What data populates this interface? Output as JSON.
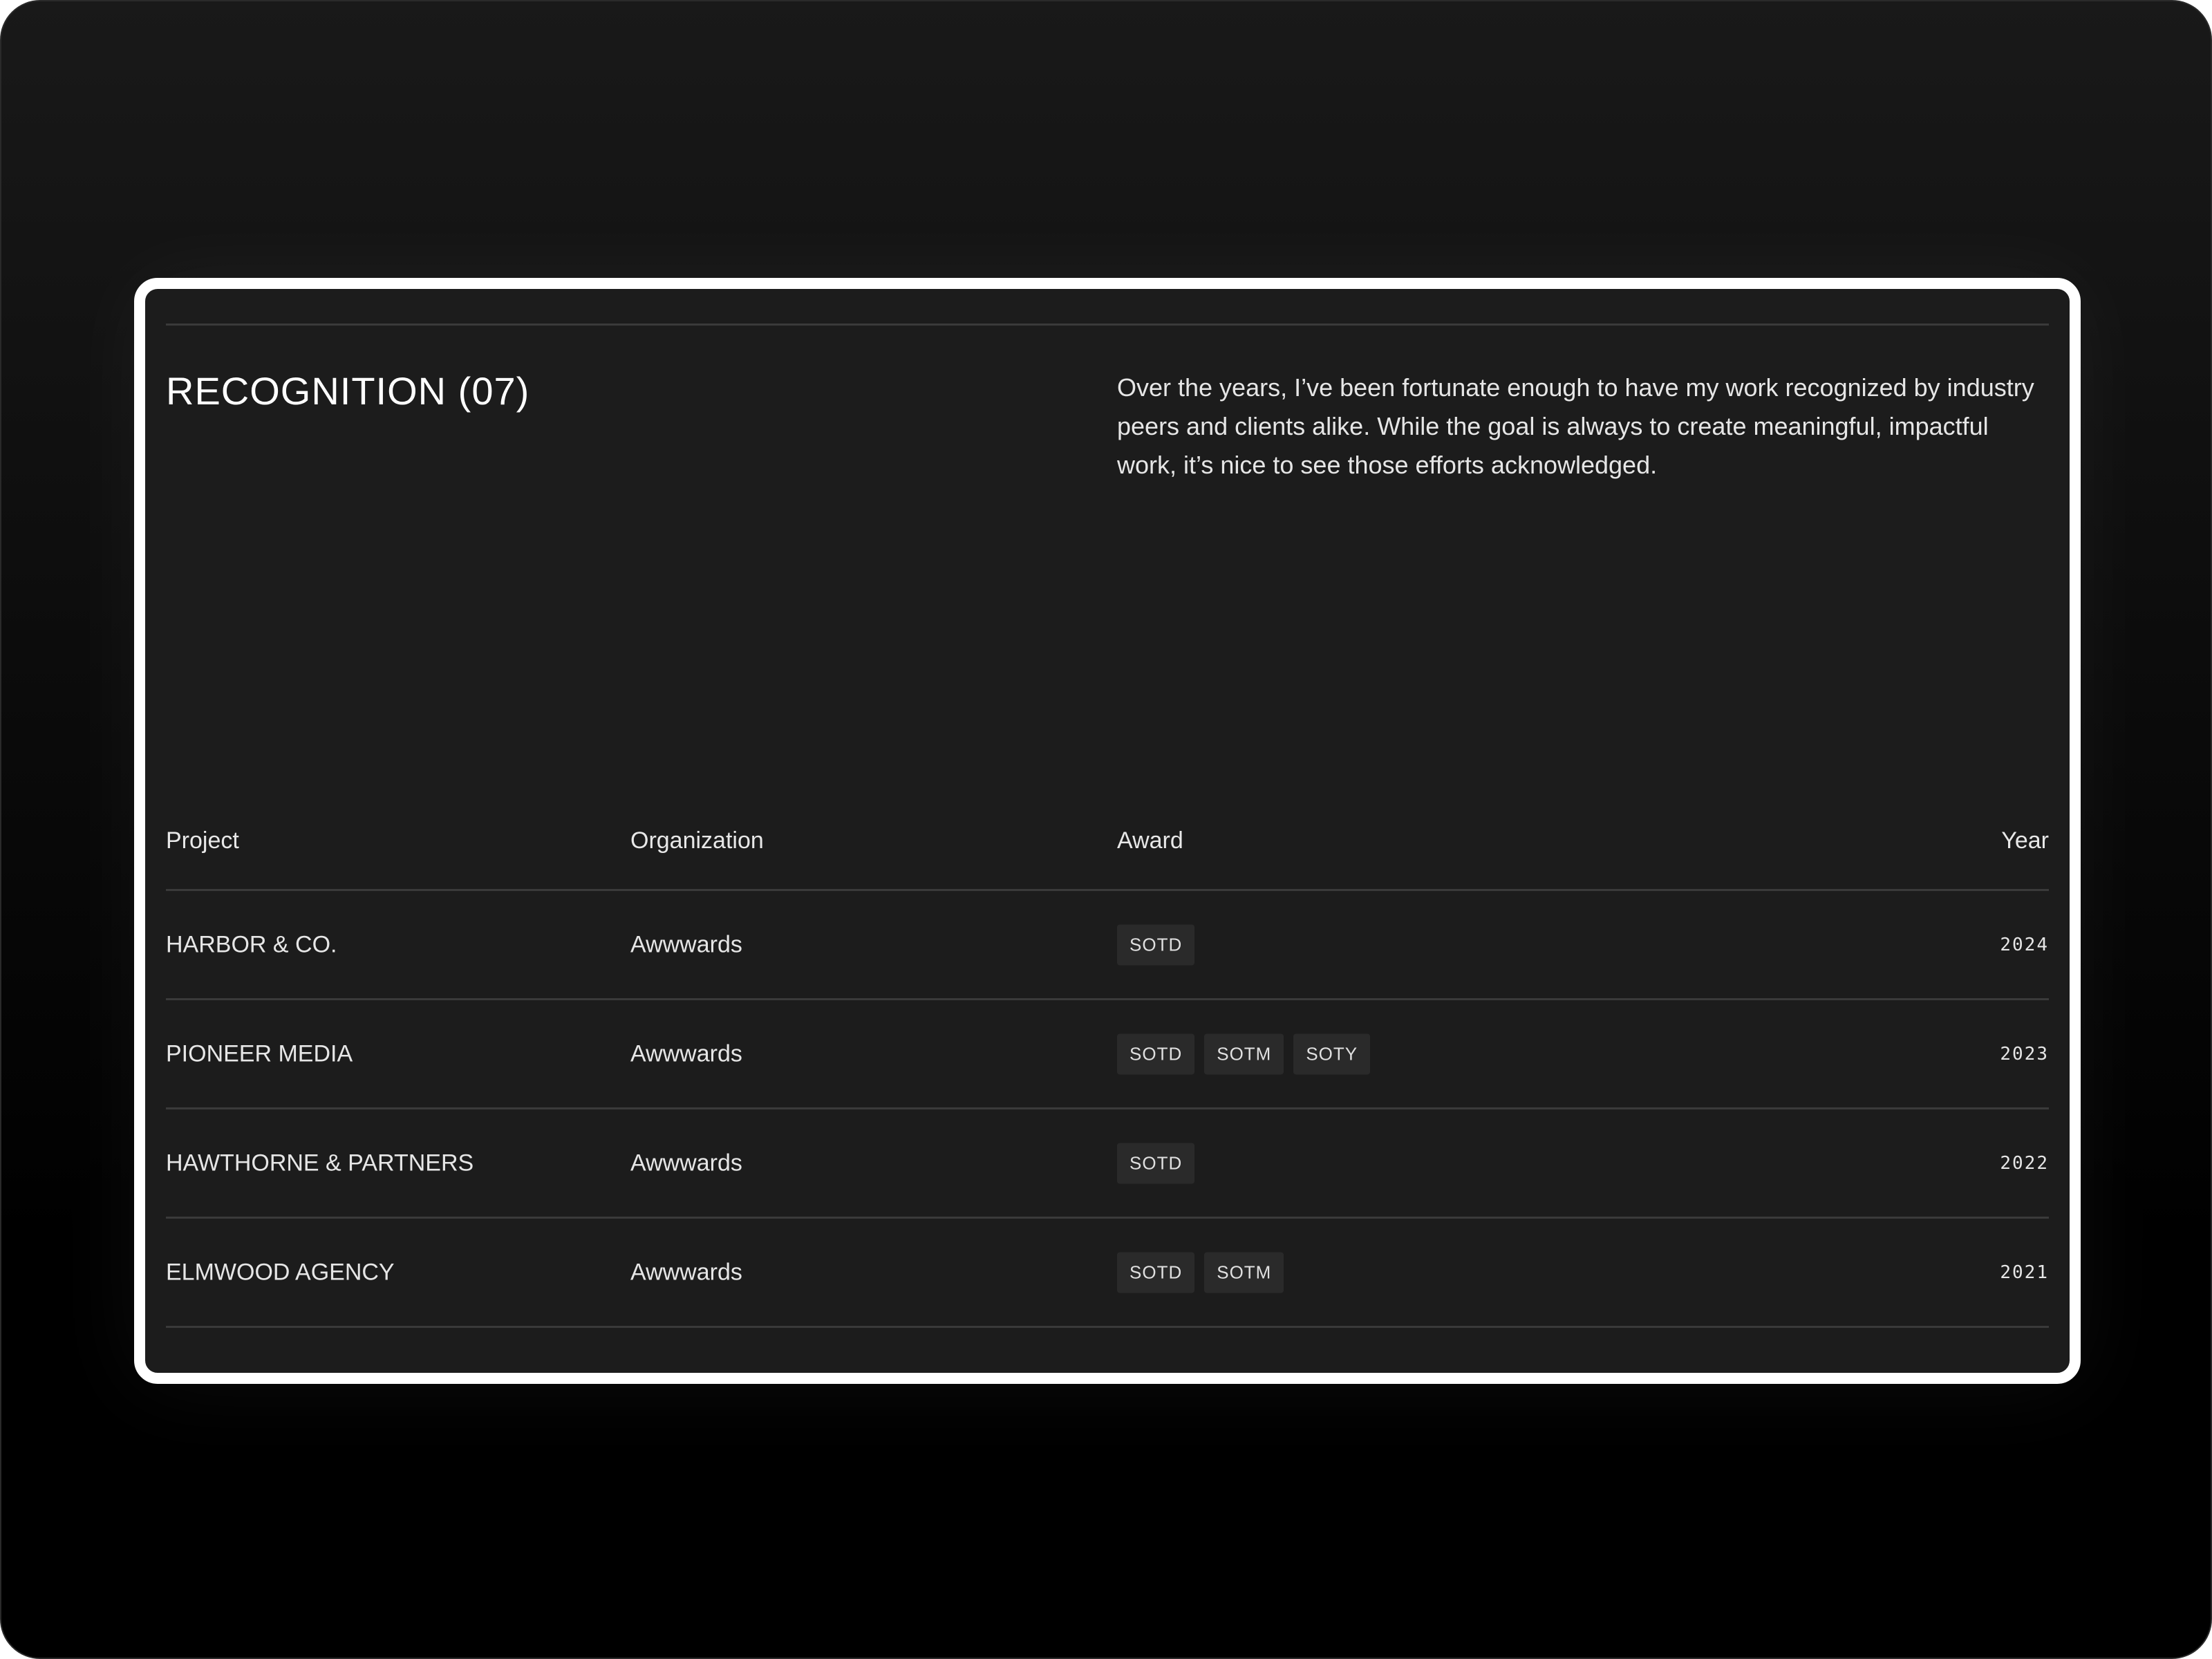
{
  "section": {
    "title": "RECOGNITION (07)",
    "intro": "Over the years, I’ve been fortunate enough to have my work recognized by industry peers and clients alike. While the goal is always to create meaningful, impactful work, it’s nice to see those efforts acknowledged."
  },
  "table": {
    "headers": {
      "project": "Project",
      "organization": "Organization",
      "award": "Award",
      "year": "Year"
    },
    "rows": [
      {
        "project": "HARBOR & CO.",
        "organization": "Awwwards",
        "awards": [
          "SOTD"
        ],
        "year": "2024"
      },
      {
        "project": "PIONEER MEDIA",
        "organization": "Awwwards",
        "awards": [
          "SOTD",
          "SOTM",
          "SOTY"
        ],
        "year": "2023"
      },
      {
        "project": "HAWTHORNE & PARTNERS",
        "organization": "Awwwards",
        "awards": [
          "SOTD"
        ],
        "year": "2022"
      },
      {
        "project": "ELMWOOD AGENCY",
        "organization": "Awwwards",
        "awards": [
          "SOTD",
          "SOTM"
        ],
        "year": "2021"
      }
    ]
  },
  "colors": {
    "panel": "#1c1c1c",
    "frame": "#ffffff",
    "divider": "#3a3a3a",
    "badge": "#2a2a2a",
    "text": "#e6e6e6"
  }
}
